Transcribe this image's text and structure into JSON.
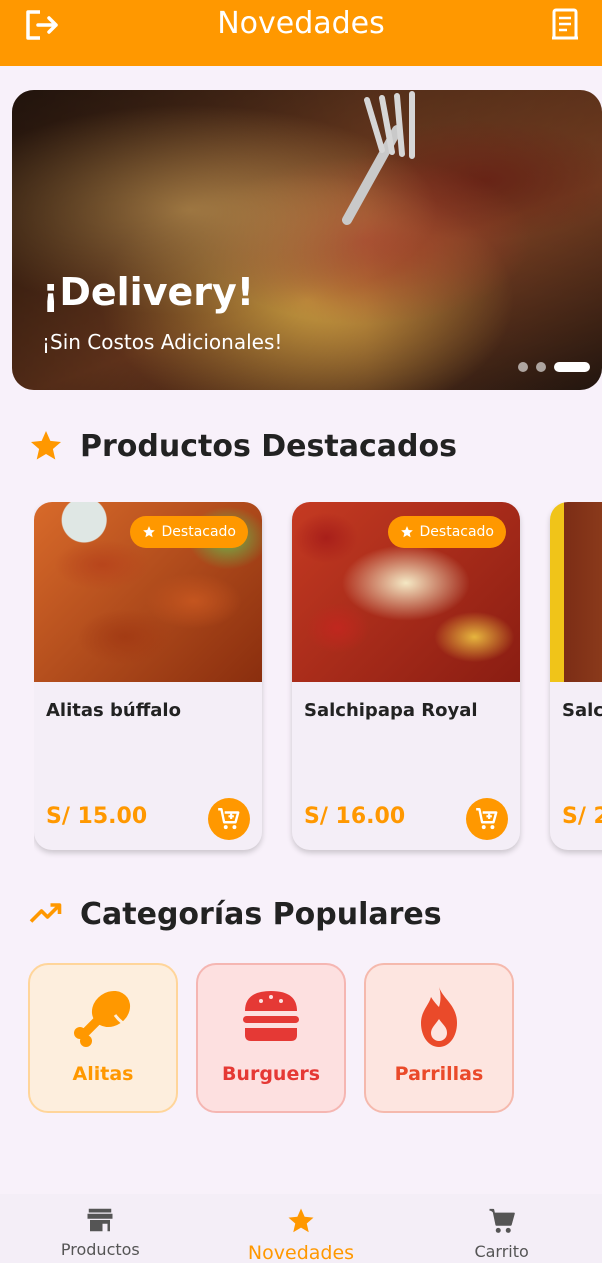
{
  "appbar": {
    "title": "Novedades",
    "left_icon": "logout-icon",
    "right_icon": "receipt-icon"
  },
  "banner": {
    "title": "¡Delivery!",
    "subtitle": "¡Sin Costos Adicionales!",
    "slide_count": 3,
    "active_slide": 3
  },
  "featured": {
    "title": "Productos Destacados",
    "icon": "star-icon",
    "items": [
      {
        "name": "Alitas búffalo",
        "price": "S/ 15.00",
        "badge": "Destacado"
      },
      {
        "name": "Salchipapa Royal",
        "price": "S/ 16.00",
        "badge": "Destacado"
      },
      {
        "name": "Salc",
        "price": "S/ 2"
      }
    ]
  },
  "categories": {
    "title": "Categorías Populares",
    "icon": "trending-up-icon",
    "items": [
      {
        "label": "Alitas",
        "icon": "drumstick-icon"
      },
      {
        "label": "Burguers",
        "icon": "burger-icon"
      },
      {
        "label": "Parrillas",
        "icon": "fire-icon"
      }
    ]
  },
  "bottomnav": {
    "items": [
      {
        "label": "Productos",
        "icon": "store-icon"
      },
      {
        "label": "Novedades",
        "icon": "star-icon",
        "active": true
      },
      {
        "label": "Carrito",
        "icon": "cart-icon"
      }
    ]
  },
  "colors": {
    "primary": "#ff9800",
    "background": "#f8f1fa",
    "burger_red": "#e53935",
    "fire_red": "#ea4a2a"
  }
}
